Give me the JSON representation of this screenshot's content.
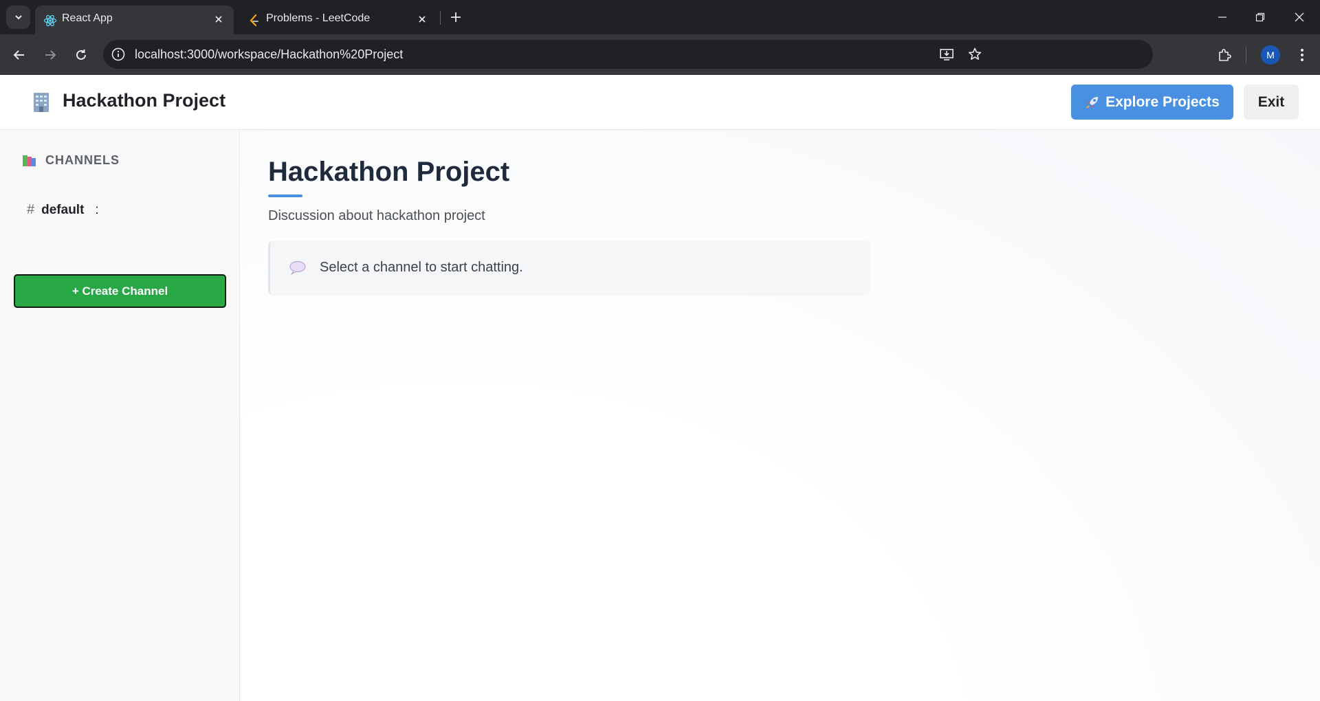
{
  "browser": {
    "tabs": [
      {
        "title": "React App",
        "active": true
      },
      {
        "title": "Problems - LeetCode",
        "active": false
      }
    ],
    "url": "localhost:3000/workspace/Hackathon%20Project",
    "profile_initial": "M"
  },
  "header": {
    "brand_title": "Hackathon Project",
    "explore_label": "Explore Projects",
    "exit_label": "Exit"
  },
  "sidebar": {
    "channels_title": "CHANNELS",
    "channels": [
      {
        "name": "default",
        "more": ":"
      }
    ],
    "create_label": "+ Create Channel"
  },
  "main": {
    "title": "Hackathon Project",
    "description": "Discussion about hackathon project",
    "empty_message": "Select a channel to start chatting."
  },
  "colors": {
    "accent": "#4a90e2",
    "create": "#28a745"
  }
}
